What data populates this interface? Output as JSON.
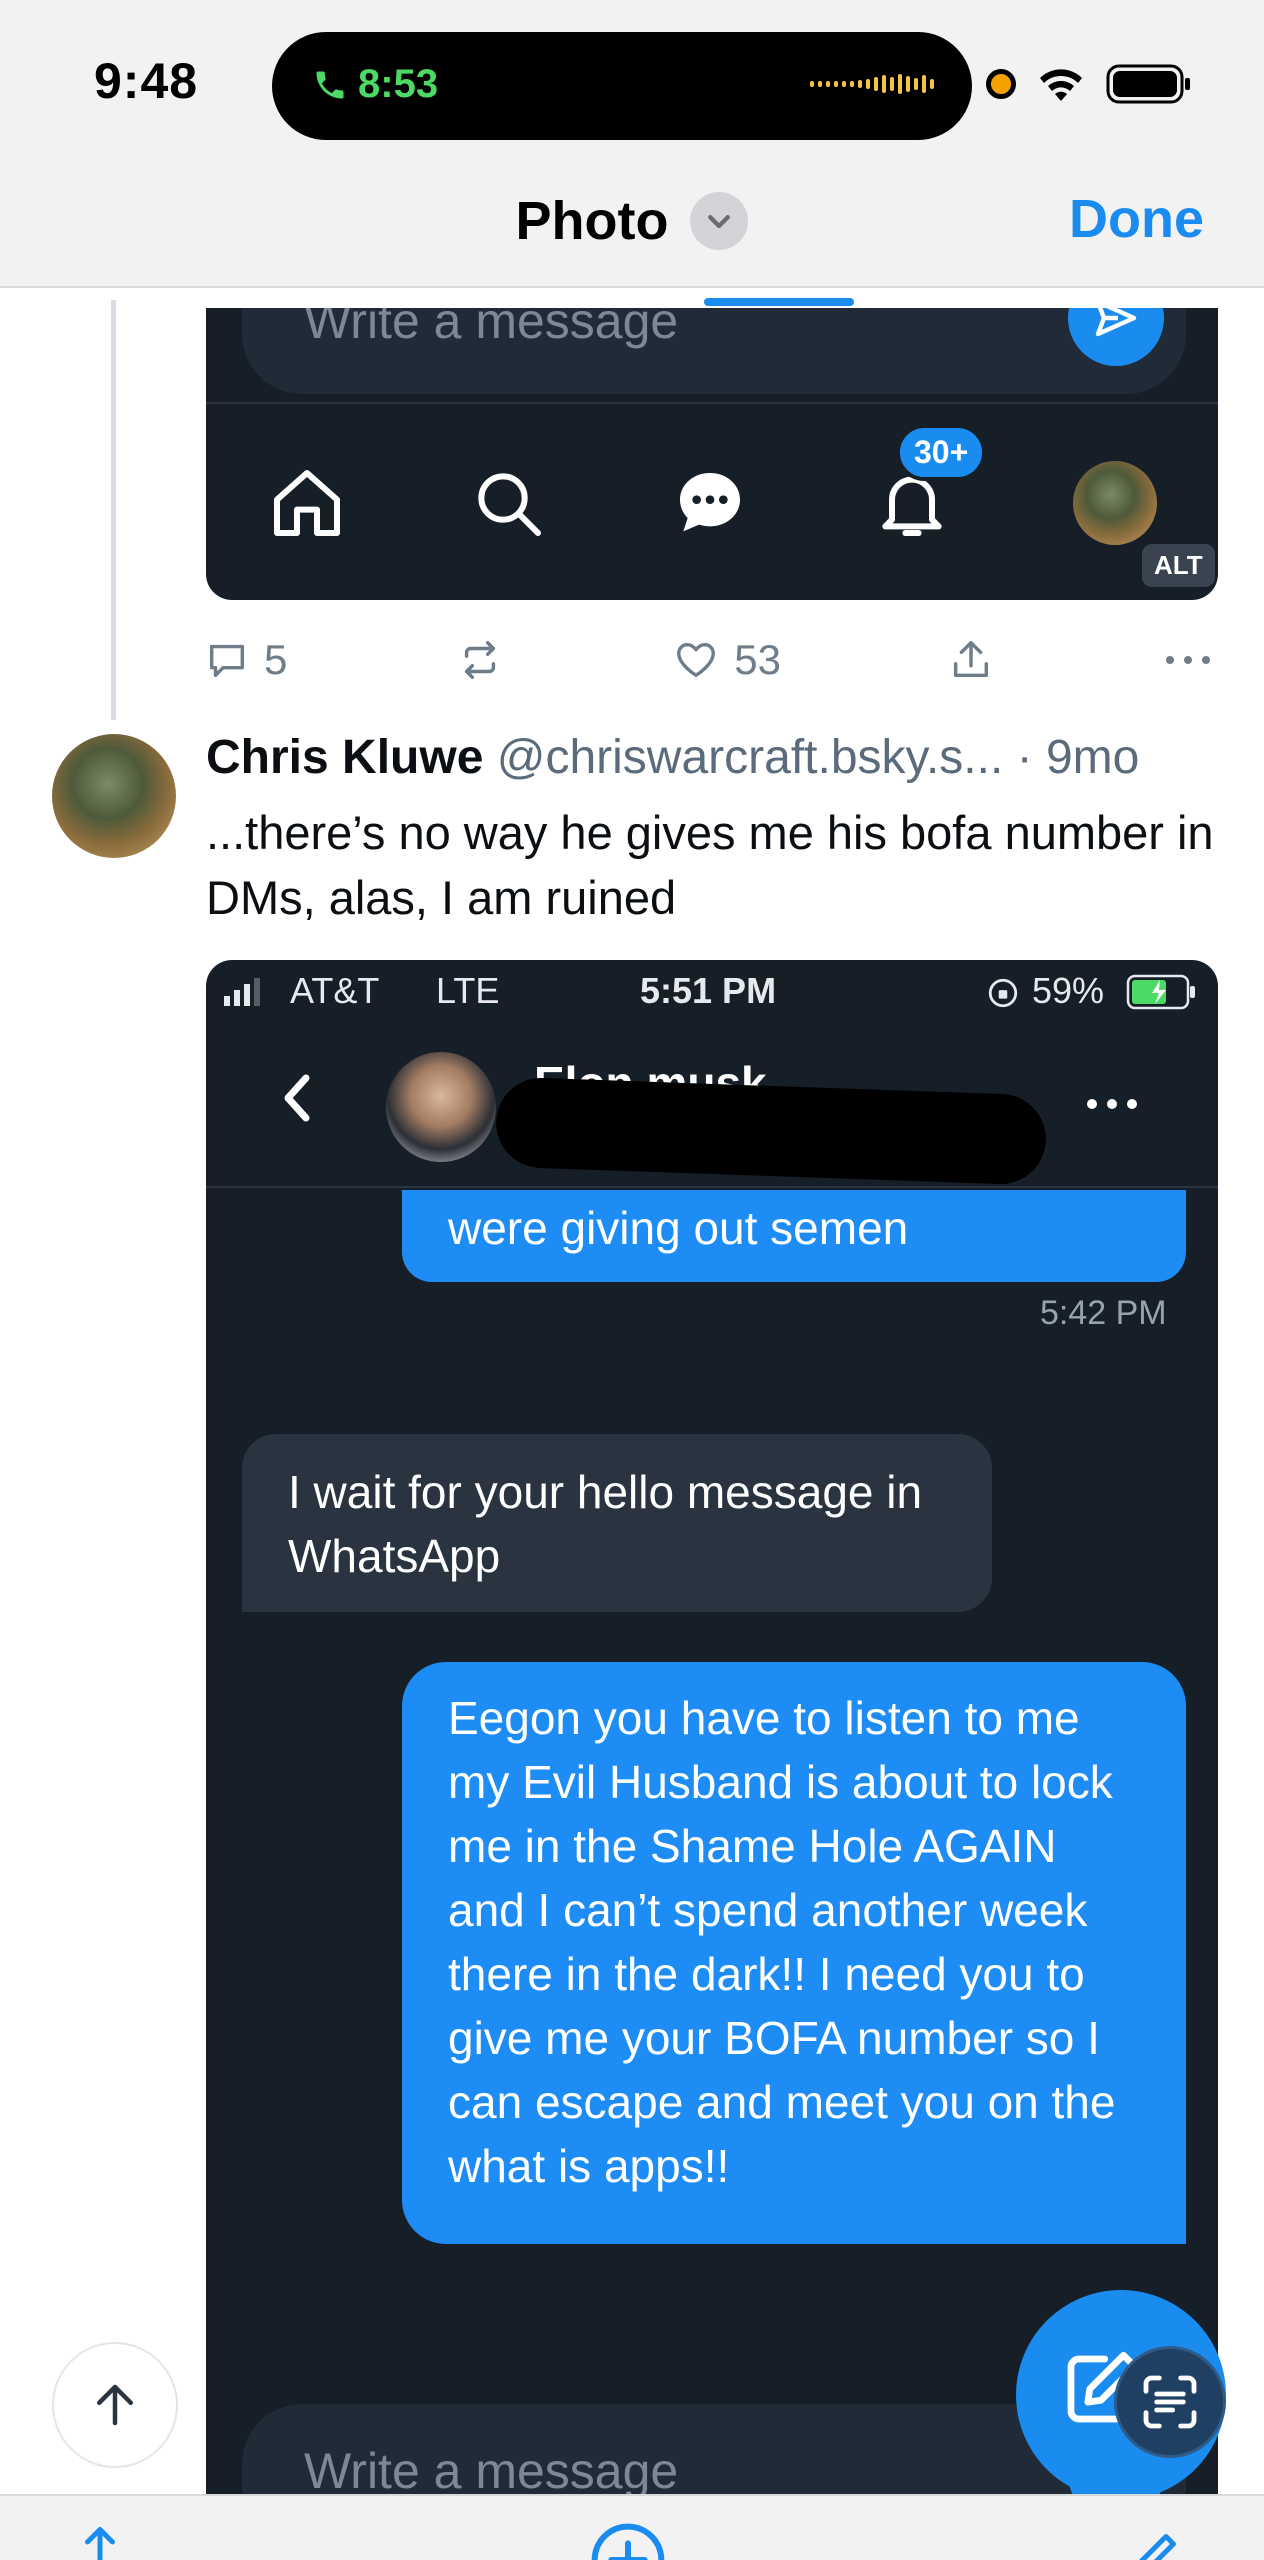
{
  "status_bar": {
    "time": "9:48",
    "call_time": "8:53"
  },
  "sheet": {
    "title": "Photo",
    "done_label": "Done"
  },
  "first_image": {
    "input_placeholder": "Write a message",
    "notif_badge": "30+",
    "alt_label": "ALT"
  },
  "actions": {
    "replies": "5",
    "likes": "53"
  },
  "post": {
    "author": "Chris Kluwe",
    "handle": "@chriswarcraft.bsky.s...",
    "age": "· 9mo",
    "text": "...there’s no way he gives me his bofa number in DMs, alas, I am ruined"
  },
  "dm_screenshot": {
    "carrier": "AT&T",
    "network": "LTE",
    "time": "5:51 PM",
    "battery": "59%",
    "contact_name": "Elon musk",
    "msg_out_1": "were giving out semen",
    "msg_out_1_time": "5:42 PM",
    "msg_in_1": "I wait for your hello message in WhatsApp",
    "msg_out_2": "Eegon you have to listen to me my Evil Husband is about to lock me in the Shame Hole AGAIN and I can’t spend another week there in the dark!! I need you to give me your BOFA number so I can escape and meet you on the what is apps!!",
    "input_placeholder": "Write a message"
  },
  "colors": {
    "accent": "#1a8cf0",
    "dark_bg": "#161e27",
    "bubble_out": "#1d8cf5",
    "bubble_in": "#2a3441"
  }
}
